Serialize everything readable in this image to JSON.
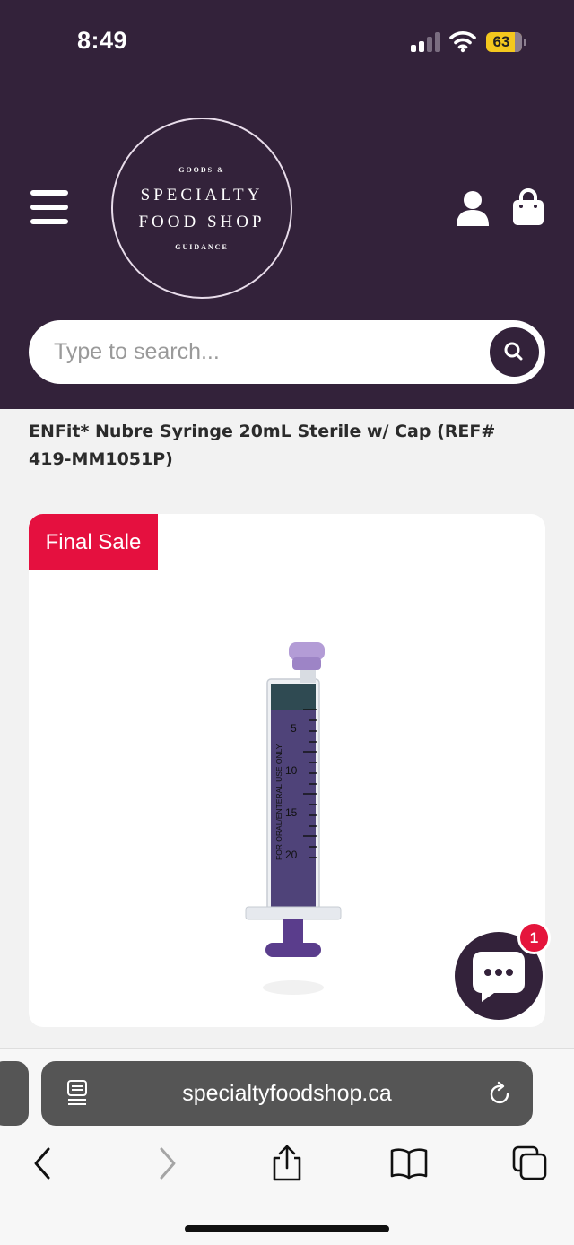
{
  "status_bar": {
    "time": "8:49",
    "battery": "63"
  },
  "header": {
    "logo": {
      "small_top": "GOODS &",
      "line1": "SPECIALTY",
      "line2": "FOOD SHOP",
      "small_bottom": "GUIDANCE"
    },
    "icons": {
      "menu": "hamburger-menu-icon",
      "account": "user-icon",
      "cart": "shopping-bag-icon"
    },
    "colors": {
      "brand": "#33223a"
    }
  },
  "search": {
    "placeholder": "Type to search..."
  },
  "product": {
    "title": "ENFit* Nubre Syringe 20mL Sterile w/ Cap (REF# 419-MM1051P)",
    "badge": "Final Sale",
    "badge_color": "#e5103f",
    "syringe_label": "FOR ORAL/ENTERAL USE ONLY",
    "scale_marks": [
      "5",
      "10",
      "15",
      "20"
    ]
  },
  "chat": {
    "unread_count": "1"
  },
  "browser": {
    "url": "specialtyfoodshop.ca"
  }
}
